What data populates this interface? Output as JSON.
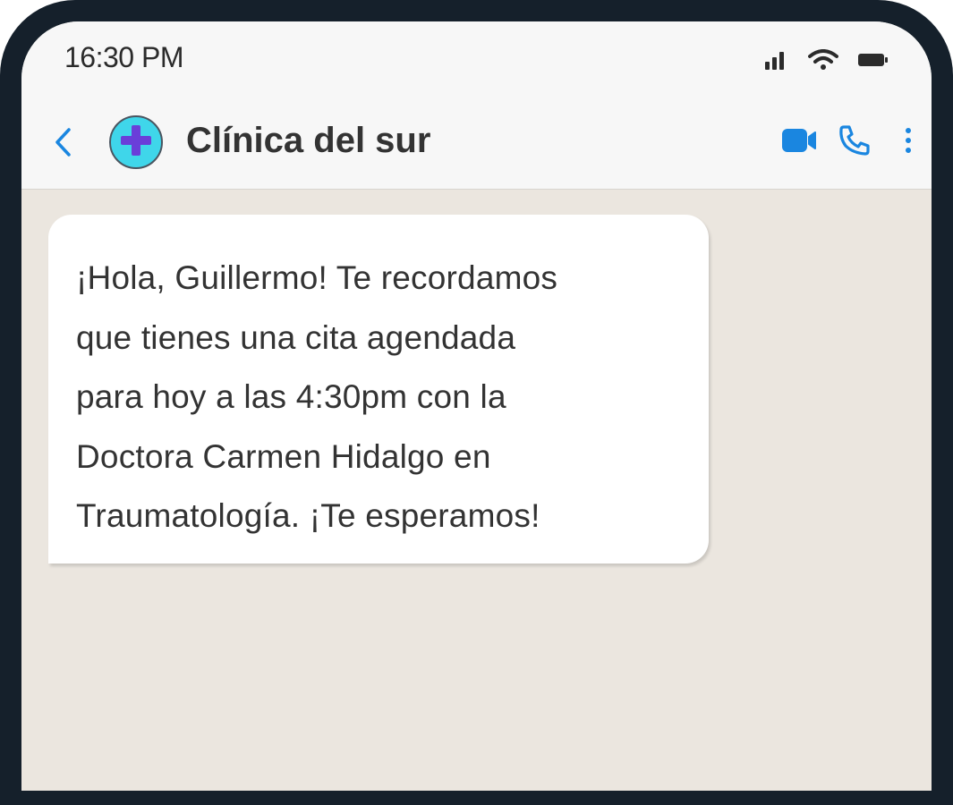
{
  "status_bar": {
    "time": "16:30 PM",
    "icons": [
      "signal-icon",
      "wifi-icon",
      "battery-icon"
    ]
  },
  "header": {
    "back_icon": "chevron-left-icon",
    "avatar_icon": "medical-cross-icon",
    "contact_name": "Clínica del sur",
    "actions": [
      {
        "name": "video-call-icon"
      },
      {
        "name": "phone-icon"
      },
      {
        "name": "more-vertical-icon"
      }
    ]
  },
  "messages": [
    {
      "direction": "incoming",
      "lines": [
        "¡Hola, Guillermo! Te recordamos",
        "que tienes una cita agendada",
        "para hoy a las 4:30pm con la",
        "Doctora Carmen Hidalgo en",
        "Traumatología. ¡Te esperamos!"
      ]
    }
  ],
  "colors": {
    "accent": "#1a86e0",
    "avatar_bg": "#3fd6ea",
    "avatar_cross": "#6a3ed9",
    "chat_bg": "#ebe6df",
    "header_bg": "#f7f7f7",
    "frame": "#15202b"
  }
}
